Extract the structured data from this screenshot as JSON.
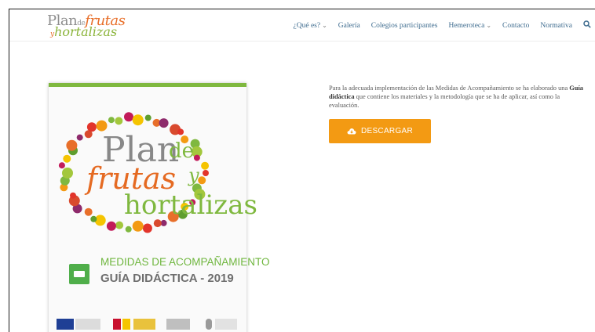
{
  "logo": {
    "plan": "Plan",
    "de": "de",
    "frutas": "frutas",
    "y": "y",
    "hortalizas": "hortalizas"
  },
  "nav": {
    "items": [
      {
        "label": "¿Qué es?",
        "chevron": true
      },
      {
        "label": "Galería",
        "chevron": false
      },
      {
        "label": "Colegios participantes",
        "chevron": false
      },
      {
        "label": "Hemeroteca",
        "chevron": true
      },
      {
        "label": "Contacto",
        "chevron": false
      },
      {
        "label": "Normativa",
        "chevron": false
      }
    ],
    "search_icon": "search-icon"
  },
  "cover": {
    "plan": "Plan",
    "de": "de",
    "frutas": "frutas",
    "y": "y",
    "hortalizas": "hortalizas",
    "medidas": "MEDIDAS DE ACOMPAÑAMIENTO",
    "guia": "GUÍA DIDÁCTICA - 2019"
  },
  "content": {
    "text_before": "Para la adecuada implementación de las Medidas de Acompañamiento se ha elaborado una ",
    "text_bold": "Guía didáctica",
    "text_after": " que contiene los materiales y la metodología que se ha de aplicar, así como la evaluación.",
    "download_label": "DESCARGAR",
    "download_icon": "cloud-download-icon"
  },
  "colors": {
    "accent": "#f39a13",
    "green": "#7fb83f",
    "orange": "#e56a22",
    "nav": "#3d6b8e"
  }
}
